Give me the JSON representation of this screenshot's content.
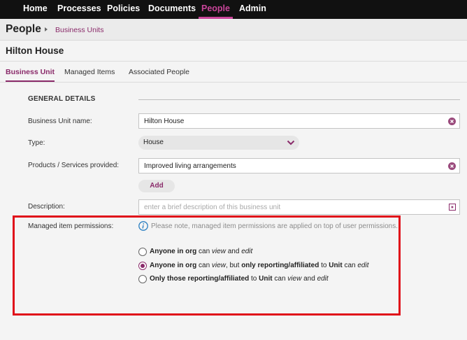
{
  "nav": {
    "items": [
      {
        "label": "Home",
        "active": false
      },
      {
        "label": "Processes",
        "active": false
      },
      {
        "label": "Policies",
        "active": false
      },
      {
        "label": "Documents",
        "active": false
      },
      {
        "label": "People",
        "active": true
      },
      {
        "label": "Admin",
        "active": false
      }
    ]
  },
  "breadcrumb": {
    "title": "People",
    "crumb": "Business Units"
  },
  "unit": {
    "title": "Hilton House"
  },
  "tabs": [
    {
      "label": "Business Unit",
      "active": true
    },
    {
      "label": "Managed Items",
      "active": false
    },
    {
      "label": "Associated People",
      "active": false
    }
  ],
  "form": {
    "section_title": "GENERAL DETAILS",
    "name": {
      "label": "Business Unit name:",
      "value": "Hilton House"
    },
    "type": {
      "label": "Type:",
      "value": "House"
    },
    "products": {
      "label": "Products / Services provided:",
      "value": "Improved living arrangements",
      "add_label": "Add"
    },
    "description": {
      "label": "Description:",
      "placeholder": "enter a brief description of this business unit"
    },
    "permissions": {
      "label": "Managed item permissions:",
      "note": "Please note, managed item permissions are applied on top of user permissions.",
      "options": [
        {
          "segments": [
            {
              "t": "Anyone in org",
              "s": "b"
            },
            {
              "t": " can ",
              "s": ""
            },
            {
              "t": "view",
              "s": "i"
            },
            {
              "t": " and ",
              "s": ""
            },
            {
              "t": "edit",
              "s": "i"
            }
          ],
          "checked": false
        },
        {
          "segments": [
            {
              "t": "Anyone in org",
              "s": "b"
            },
            {
              "t": " can ",
              "s": ""
            },
            {
              "t": "view",
              "s": "i"
            },
            {
              "t": ", but ",
              "s": ""
            },
            {
              "t": "only reporting/affiliated",
              "s": "b"
            },
            {
              "t": " to ",
              "s": ""
            },
            {
              "t": "Unit",
              "s": "b"
            },
            {
              "t": " can ",
              "s": ""
            },
            {
              "t": "edit",
              "s": "i"
            }
          ],
          "checked": true
        },
        {
          "segments": [
            {
              "t": "Only those reporting/affiliated",
              "s": "b"
            },
            {
              "t": " to ",
              "s": ""
            },
            {
              "t": "Unit",
              "s": "b"
            },
            {
              "t": " can ",
              "s": ""
            },
            {
              "t": "view",
              "s": "i"
            },
            {
              "t": " and ",
              "s": ""
            },
            {
              "t": "edit",
              "s": "i"
            }
          ],
          "checked": false
        }
      ]
    }
  },
  "colors": {
    "accent": "#8a2b6a",
    "nav_active": "#c9459a",
    "highlight": "#e0101a",
    "info": "#2a7fc1"
  }
}
